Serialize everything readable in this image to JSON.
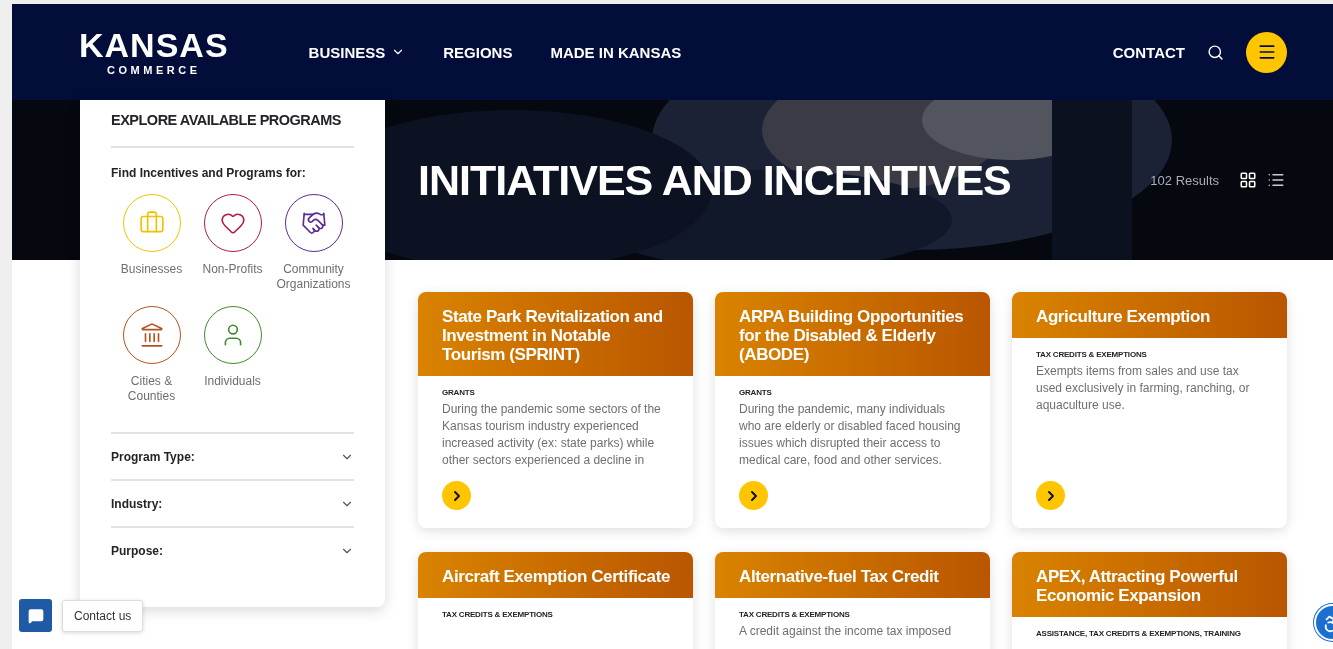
{
  "header": {
    "logo": {
      "main": "KANSAS",
      "sub": "COMMERCE"
    },
    "nav": [
      {
        "label": "BUSINESS",
        "has_dropdown": true
      },
      {
        "label": "REGIONS",
        "has_dropdown": false
      },
      {
        "label": "MADE IN KANSAS",
        "has_dropdown": false
      }
    ],
    "contact": "CONTACT"
  },
  "hero": {
    "title": "INITIATIVES AND INCENTIVES",
    "results": "102 Results"
  },
  "sidebar": {
    "title": "EXPLORE AVAILABLE PROGRAMS",
    "subtitle": "Find Incentives and Programs for:",
    "audiences": [
      {
        "label": "Businesses",
        "color": "#f2c200"
      },
      {
        "label": "Non-Profits",
        "color": "#b3194f"
      },
      {
        "label": "Community Organizations",
        "color": "#5b2a95"
      },
      {
        "label": "Cities & Counties",
        "color": "#b2521f"
      },
      {
        "label": "Individuals",
        "color": "#3f8a2c"
      }
    ],
    "filters": [
      {
        "label": "Program Type:"
      },
      {
        "label": "Industry:"
      },
      {
        "label": "Purpose:"
      }
    ]
  },
  "cards": [
    {
      "title": "State Park Revitalization and Investment in Notable Tourism (SPRINT)",
      "category": "GRANTS",
      "description": "During the pandemic some sectors of the Kansas tourism industry experienced increased activity (ex: state parks) while other sectors experienced a decline in"
    },
    {
      "title": "ARPA Building Opportunities for the Disabled & Elderly (ABODE)",
      "category": "GRANTS",
      "description": "During the pandemic, many individuals who are elderly or disabled faced housing issues which disrupted their access to medical care, food and other services."
    },
    {
      "title": "Agriculture Exemption",
      "category": "TAX CREDITS & EXEMPTIONS",
      "description": "Exempts items from sales and use tax used exclusively in farming, ranching, or aquaculture use."
    },
    {
      "title": "Aircraft Exemption Certificate",
      "category": "TAX CREDITS & EXEMPTIONS"
    },
    {
      "title": "Alternative-fuel Tax Credit",
      "category": "TAX CREDITS & EXEMPTIONS",
      "description": "A credit against the income tax imposed"
    },
    {
      "title": "APEX, Attracting Powerful Economic Expansion",
      "category": "ASSISTANCE, TAX CREDITS & EXEMPTIONS, TRAINING"
    }
  ],
  "chat": {
    "label": "Contact us"
  }
}
